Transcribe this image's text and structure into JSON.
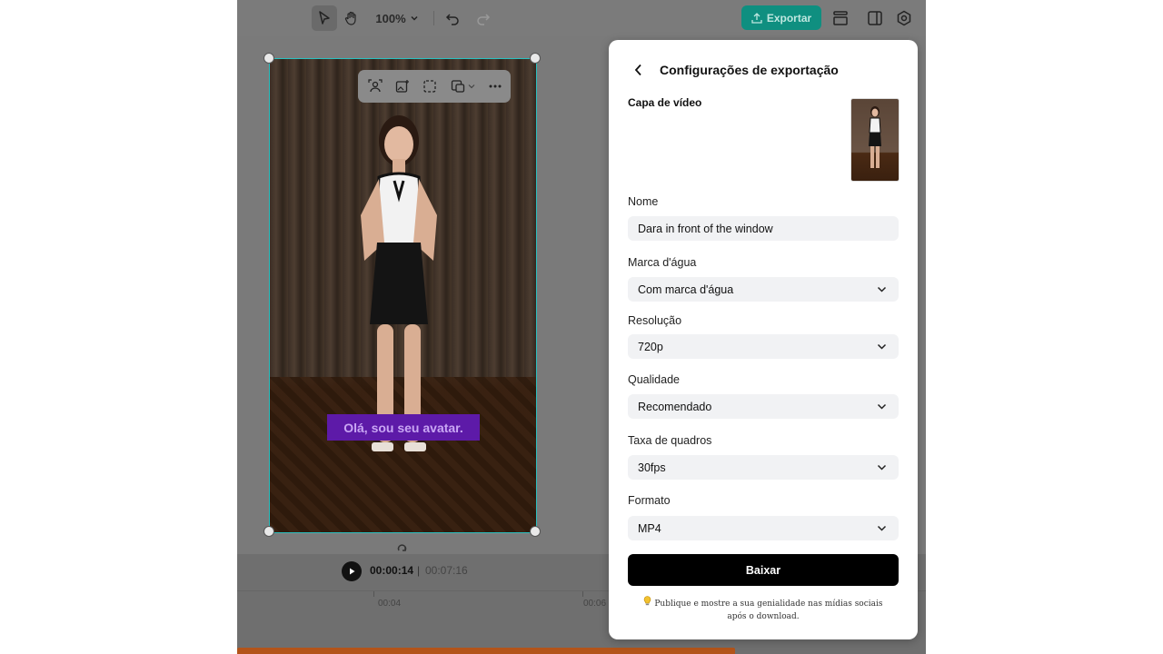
{
  "toolbar": {
    "zoom": "100%",
    "export_label": "Exportar"
  },
  "video": {
    "subtitle": "Olá, sou seu avatar."
  },
  "playback": {
    "current_time": "00:00:14",
    "separator": "|",
    "total_time": "00:07:16"
  },
  "timeline": {
    "ticks": [
      "00:04",
      "00:06"
    ]
  },
  "export_panel": {
    "title": "Configurações de exportação",
    "cover_label": "Capa de vídeo",
    "name_label": "Nome",
    "name_value": "Dara in front of the window",
    "watermark_label": "Marca d'água",
    "watermark_value": "Com marca d'água",
    "resolution_label": "Resolução",
    "resolution_value": "720p",
    "quality_label": "Qualidade",
    "quality_value": "Recomendado",
    "framerate_label": "Taxa de quadros",
    "framerate_value": "30fps",
    "format_label": "Formato",
    "format_value": "MP4",
    "download_label": "Baixar",
    "tip_icon": "lightbulb-icon",
    "tip_text": "Publique e mostre a sua genialidade nas mídias sociais após o download."
  },
  "colors": {
    "export_button": "#0f8f80",
    "subtitle_background": "#5d1aa8",
    "download_button": "#000000",
    "selection_border": "#2ac0c0"
  }
}
